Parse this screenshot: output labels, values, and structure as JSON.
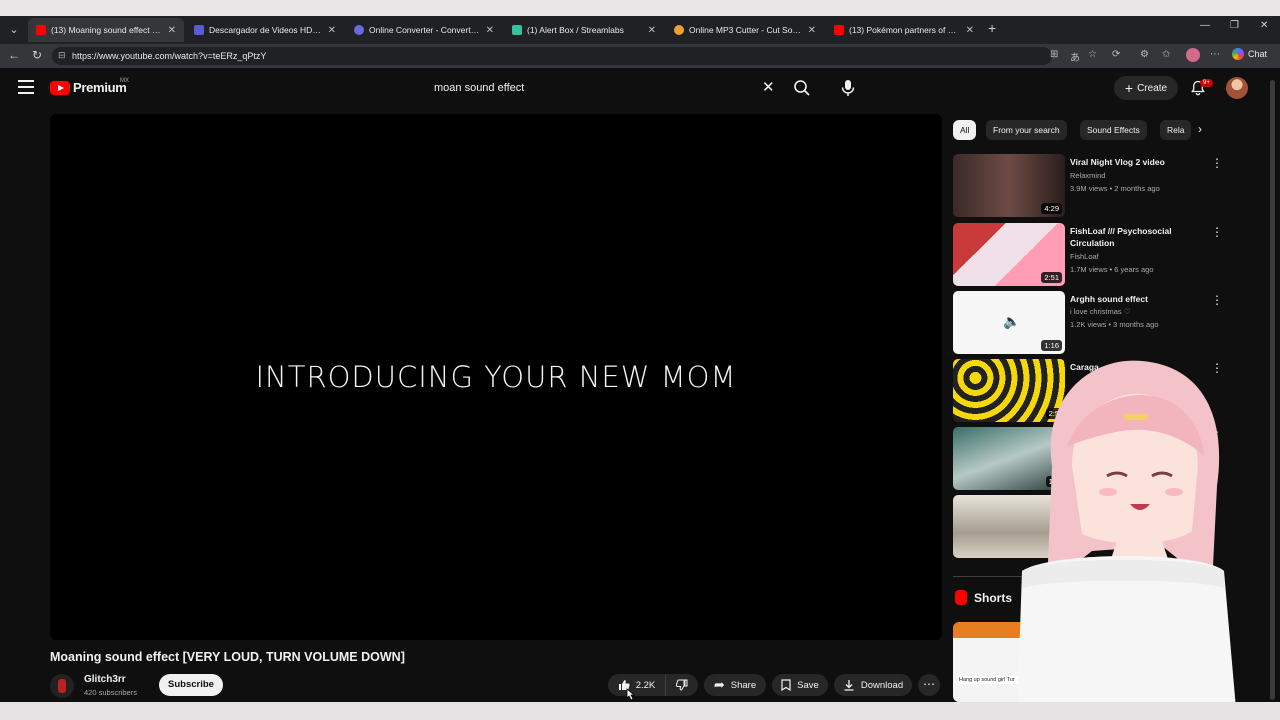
{
  "browser": {
    "tabs": [
      {
        "title": "(13) Moaning sound effect [VERY LO...",
        "color": "#ff0000",
        "active": true
      },
      {
        "title": "Descargador de Videos HD de YouTube",
        "color": "#5b5bd6",
        "active": false
      },
      {
        "title": "Online Converter - Convert Image, Video",
        "color": "#6a6ad9",
        "active": false
      },
      {
        "title": "(1) Alert Box / Streamlabs",
        "color": "#31c3a2",
        "active": false
      },
      {
        "title": "Online MP3 Cutter - Cut Songs, Make",
        "color": "#f0a030",
        "active": false
      },
      {
        "title": "(13) Pokémon partners of different type",
        "color": "#ff0000",
        "active": false
      }
    ],
    "url": "https://www.youtube.com/watch?v=teERz_qPtzY",
    "chat_label": "Chat"
  },
  "header": {
    "brand": "Premium",
    "region": "MX",
    "search_query": "moan sound effect",
    "create_label": "Create",
    "notifications": "9+"
  },
  "player": {
    "overlay_text": "INTRODUCING YOUR NEW MOM"
  },
  "video": {
    "title": "Moaning sound effect [VERY LOUD, TURN VOLUME DOWN]",
    "channel": "Glitch3rr",
    "subscribers": "420 subscribers",
    "subscribe_label": "Subscribe",
    "likes": "2.2K",
    "share_label": "Share",
    "save_label": "Save",
    "download_label": "Download"
  },
  "sidebar": {
    "chips": [
      "All",
      "From your search",
      "Sound Effects",
      "Rela"
    ],
    "recommendations": [
      {
        "title": "Viral Night Vlog 2 video",
        "channel": "Relaxmind",
        "meta": "3.9M views • 2 months ago",
        "duration": "4:29"
      },
      {
        "title": "FishLoaf /// Psychosocial Circulation",
        "channel": "FishLoaf",
        "meta": "1.7M views • 6 years ago",
        "duration": "2:51"
      },
      {
        "title": "Arghh sound effect",
        "channel": "i love christmas ♡",
        "meta": "1.2K views • 3 months ago",
        "duration": "1:16"
      },
      {
        "title": "Caraga...",
        "channel": "",
        "meta": "",
        "duration": "2:5"
      },
      {
        "title": "",
        "channel": "",
        "meta": "",
        "duration": "1:0"
      },
      {
        "title": "",
        "channel": "",
        "meta": "",
        "duration": ""
      }
    ],
    "shorts_label": "Shorts",
    "short_caption": "Hang up sound girl Tur"
  },
  "colors": {
    "background": "#0f0f0f",
    "brand_red": "#ff0000",
    "chip_bg": "#272727"
  }
}
